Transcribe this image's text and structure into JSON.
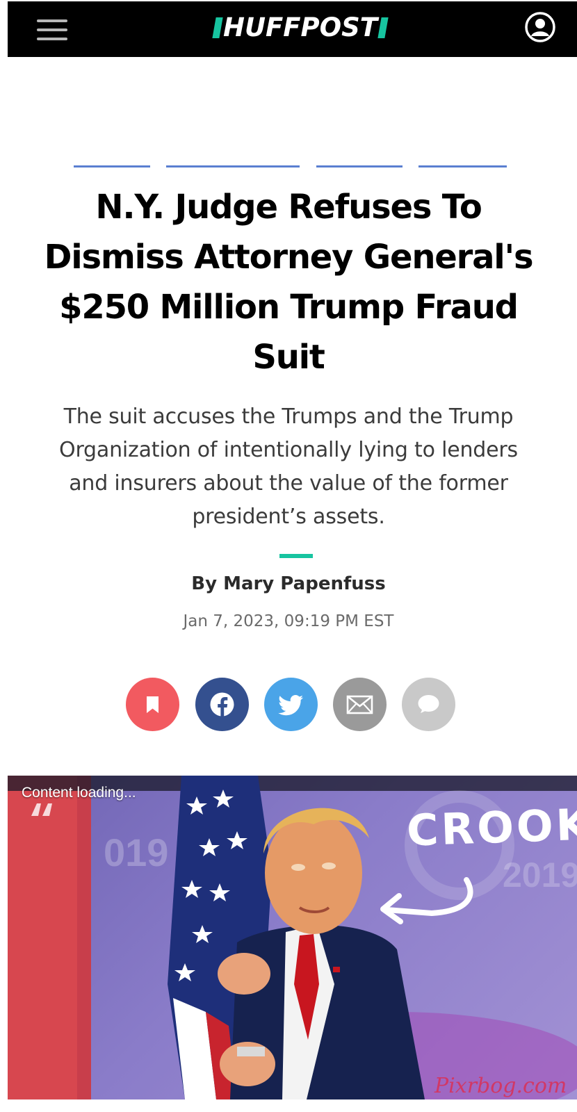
{
  "colors": {
    "accent": "#17c4a0",
    "header_bg": "#000000",
    "category_link": "#5a7fd1",
    "bookmark": "#f25a60",
    "facebook": "#34508f",
    "twitter": "#4aa4e8",
    "email": "#9a9a9a",
    "comment": "#c9c9c9"
  },
  "header": {
    "logo": "HUFFPOST",
    "menu_icon": "hamburger-menu-icon",
    "account_icon": "user-account-icon"
  },
  "article": {
    "headline": "N.Y. Judge Refuses To Dismiss Attorney General's $250 Million Trump Fraud Suit",
    "dek": "The suit accuses the Trumps and the Trump Organization of intentionally lying to lenders and insurers about the value of the former president’s assets.",
    "byline": "By Mary Papenfuss",
    "timestamp": "Jan 7, 2023, 09:19 PM EST"
  },
  "share": {
    "items": [
      {
        "name": "bookmark",
        "icon": "bookmark-icon"
      },
      {
        "name": "facebook",
        "icon": "facebook-icon"
      },
      {
        "name": "twitter",
        "icon": "twitter-icon"
      },
      {
        "name": "email",
        "icon": "email-icon"
      },
      {
        "name": "comments",
        "icon": "comment-icon"
      }
    ]
  },
  "lead_image": {
    "loading_text": "Content loading...",
    "overlay_text": "CROOK",
    "watermark": "Pixrbog.com"
  }
}
